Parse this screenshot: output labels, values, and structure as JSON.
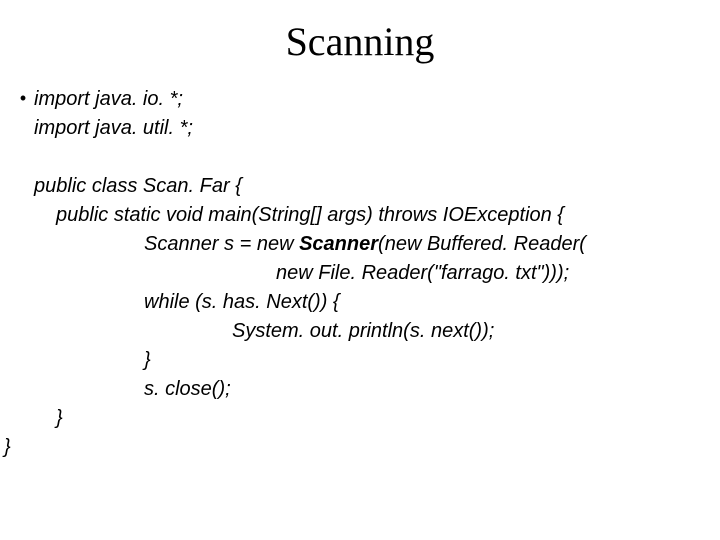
{
  "title": "Scanning",
  "lines": {
    "l1": "import java. io. *;",
    "l2": "import java. util. *;",
    "l3": "public class Scan. Far {",
    "l4": "public static void main(String[] args) throws IOException {",
    "l5a": "Scanner s = new ",
    "l5b": "Scanner",
    "l5c": "(new Buffered. Reader(",
    "l6": "new File. Reader(\"farrago. txt\")));",
    "l7": "while (s. has. Next()) {",
    "l8": "System. out. println(s. next());",
    "l9": "}",
    "l10": "s. close();",
    "l11": "}",
    "l12": "}"
  }
}
